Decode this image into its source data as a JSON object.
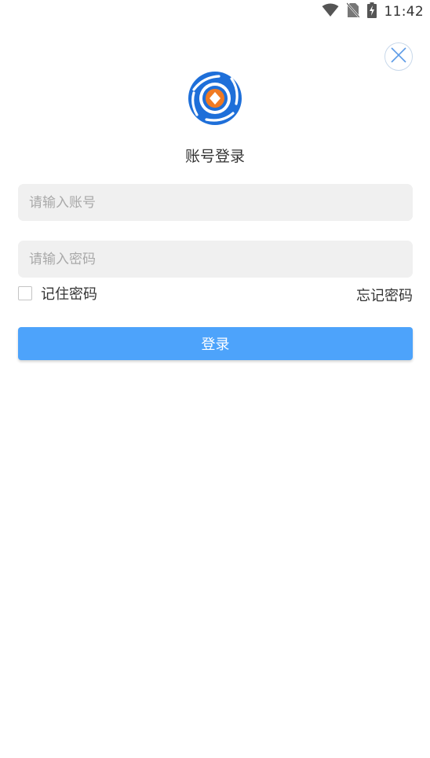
{
  "status_bar": {
    "time": "11:42",
    "icons": [
      "wifi-icon",
      "no-sim-icon",
      "battery-charging-icon"
    ]
  },
  "header": {
    "close_icon": "close-icon",
    "logo_icon": "app-logo",
    "title": "账号登录"
  },
  "form": {
    "account_placeholder": "请输入账号",
    "account_value": "",
    "password_placeholder": "请输入密码",
    "password_value": "",
    "remember_label": "记住密码",
    "remember_checked": false,
    "forgot_label": "忘记密码",
    "login_label": "登录"
  },
  "colors": {
    "accent": "#4da3fb",
    "logo_blue": "#1e6fd9",
    "logo_orange": "#f07a22",
    "field_bg": "#f0f0f0"
  }
}
